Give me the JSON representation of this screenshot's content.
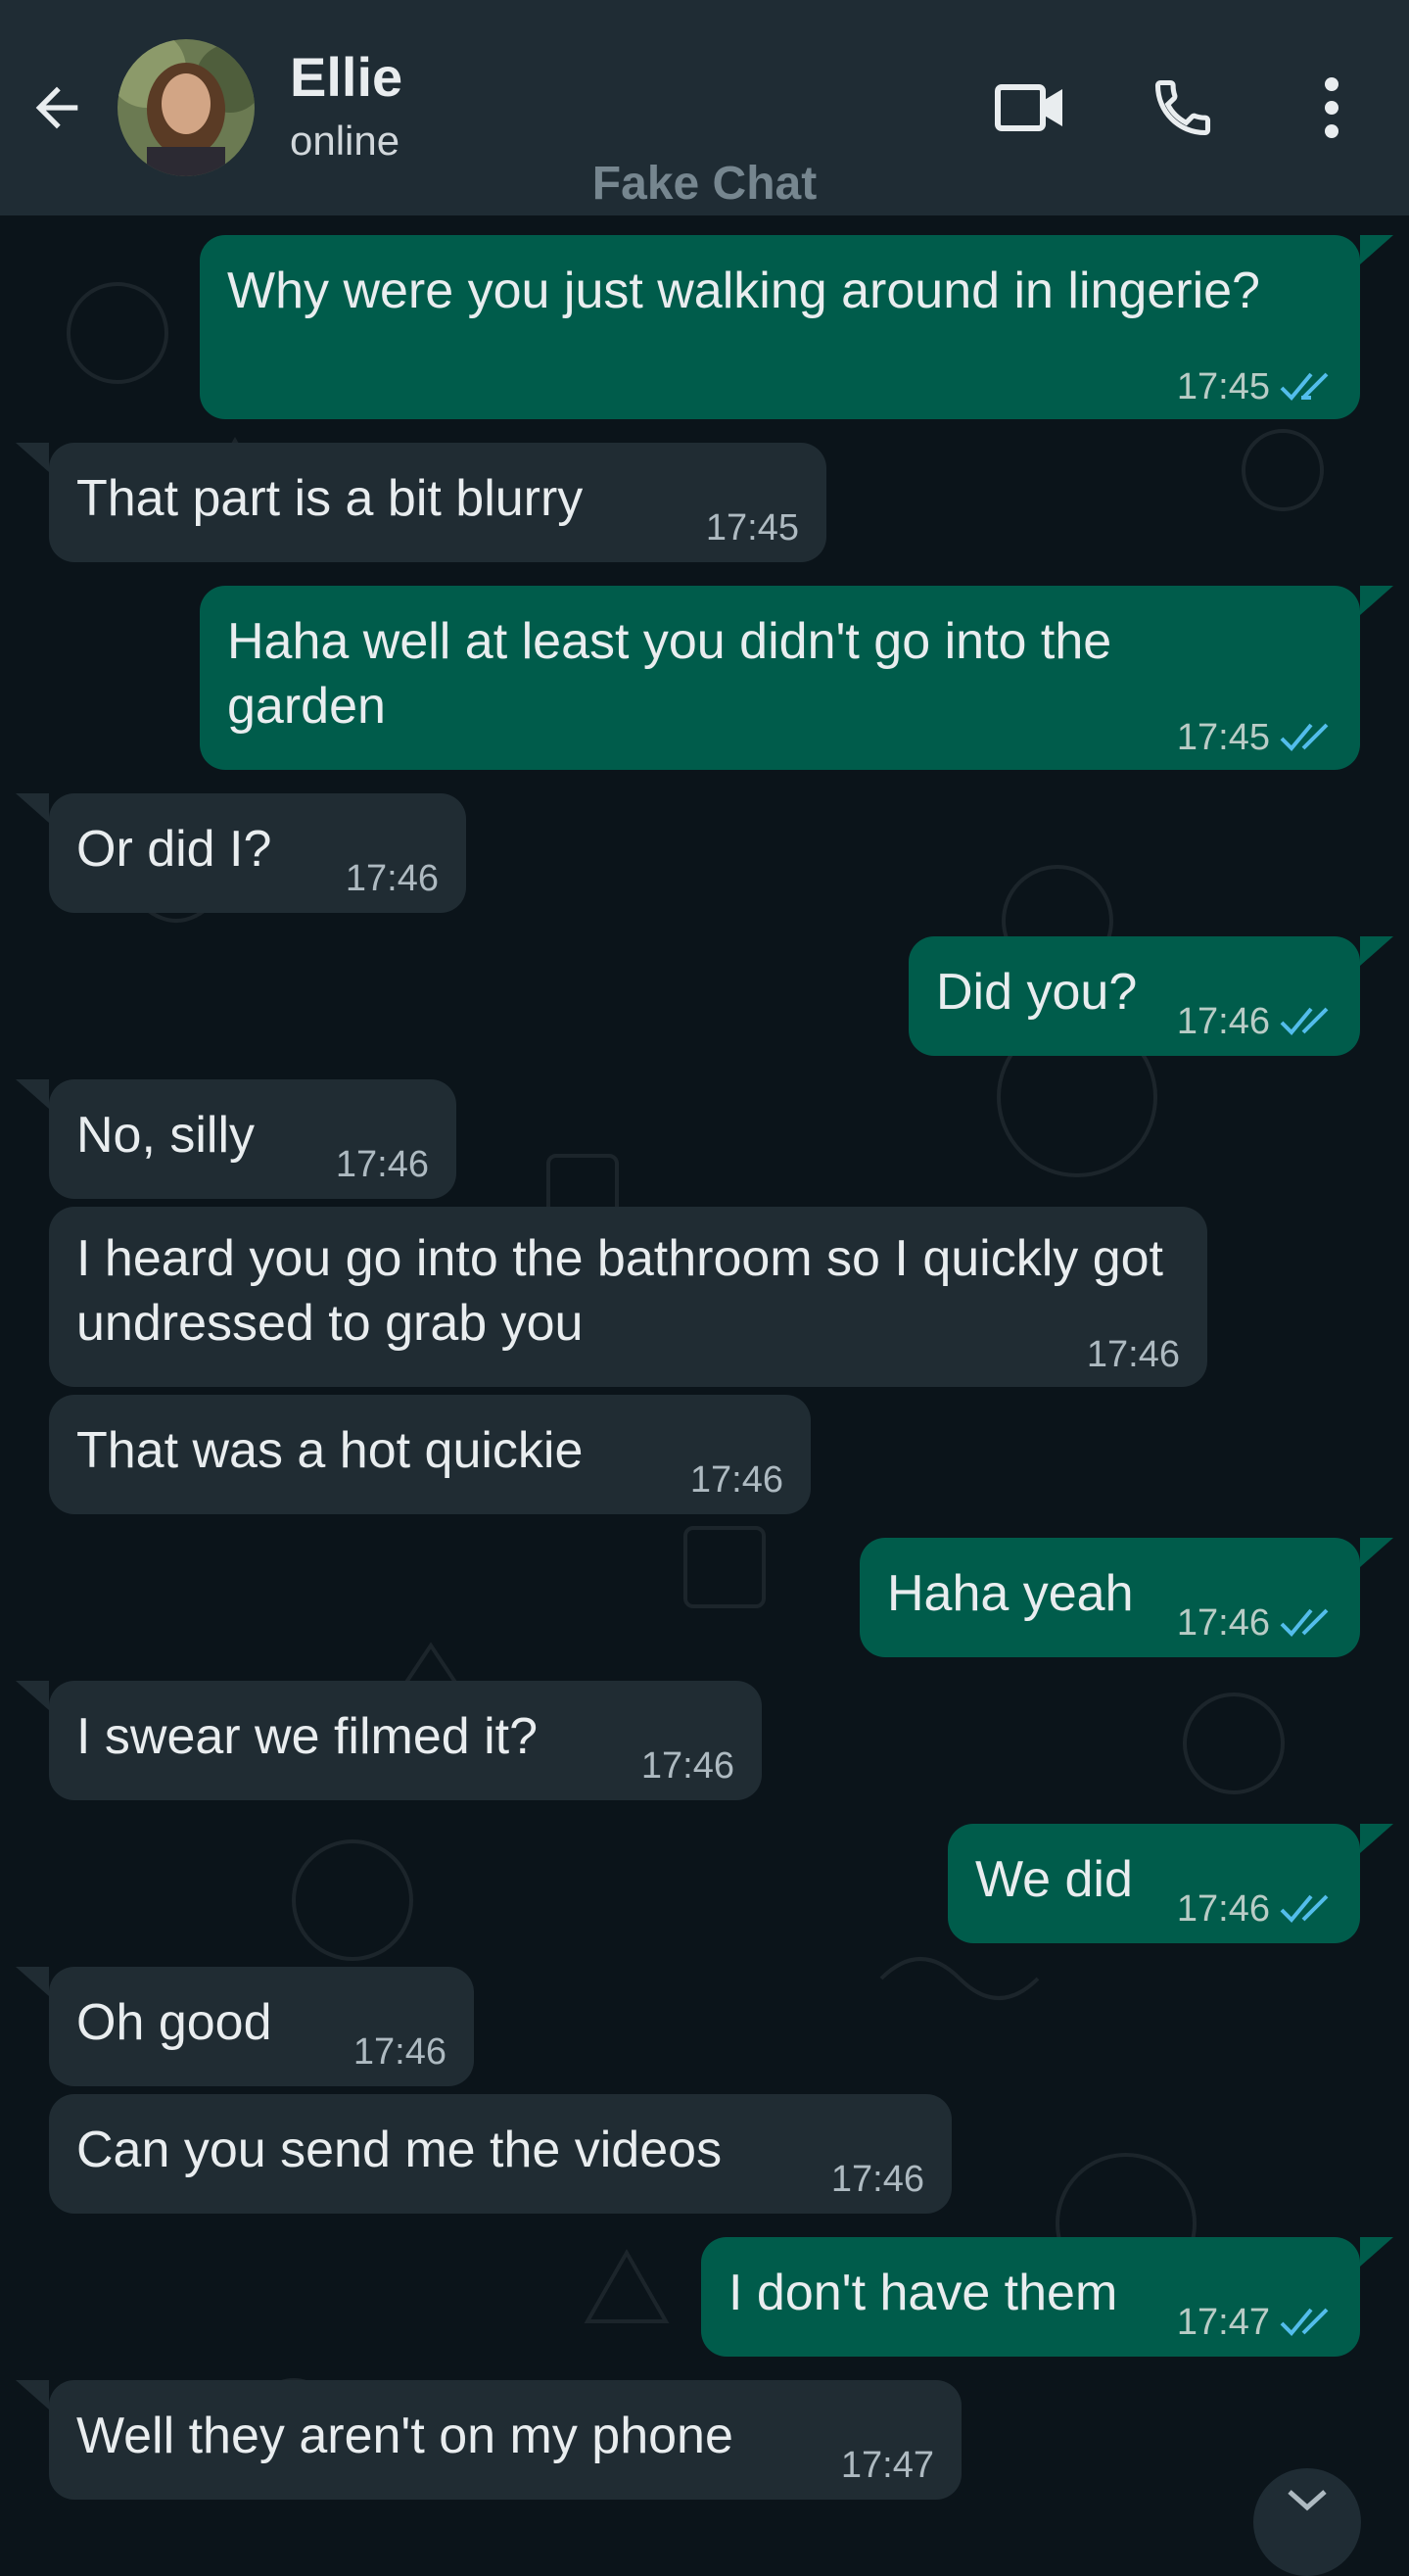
{
  "header": {
    "contact_name": "Ellie",
    "contact_status": "online",
    "watermark": "Fake Chat",
    "icons": [
      "back-arrow-icon",
      "video-call-icon",
      "phone-icon",
      "more-vert-icon"
    ]
  },
  "colors": {
    "header_bg": "#1f2c34",
    "chat_bg": "#0b141a",
    "incoming_bubble": "#202c33",
    "outgoing_bubble": "#005c4b",
    "read_ticks": "#53bdeb"
  },
  "messages": [
    {
      "dir": "out",
      "text": "Why were you just walking around in lingerie?",
      "time": "17:45",
      "read": true
    },
    {
      "dir": "in",
      "text": "That part is a bit blurry",
      "time": "17:45"
    },
    {
      "dir": "out",
      "text": "Haha well at least you didn't go into the garden",
      "time": "17:45",
      "read": true
    },
    {
      "dir": "in",
      "text": "Or did I?",
      "time": "17:46"
    },
    {
      "dir": "out",
      "text": "Did you?",
      "time": "17:46",
      "read": true
    },
    {
      "dir": "in",
      "text": "No, silly",
      "time": "17:46"
    },
    {
      "dir": "in",
      "text": "I heard you go into the bathroom so I quickly got undressed to grab you",
      "time": "17:46"
    },
    {
      "dir": "in",
      "text": "That was a hot quickie",
      "time": "17:46"
    },
    {
      "dir": "out",
      "text": "Haha yeah",
      "time": "17:46",
      "read": true
    },
    {
      "dir": "in",
      "text": "I swear we filmed it?",
      "time": "17:46"
    },
    {
      "dir": "out",
      "text": "We did",
      "time": "17:46",
      "read": true
    },
    {
      "dir": "in",
      "text": "Oh good",
      "time": "17:46"
    },
    {
      "dir": "in",
      "text": "Can you send me the videos",
      "time": "17:46"
    },
    {
      "dir": "out",
      "text": "I don't have them",
      "time": "17:47",
      "read": true
    },
    {
      "dir": "in",
      "text": "Well they aren't on my phone",
      "time": "17:47"
    }
  ]
}
